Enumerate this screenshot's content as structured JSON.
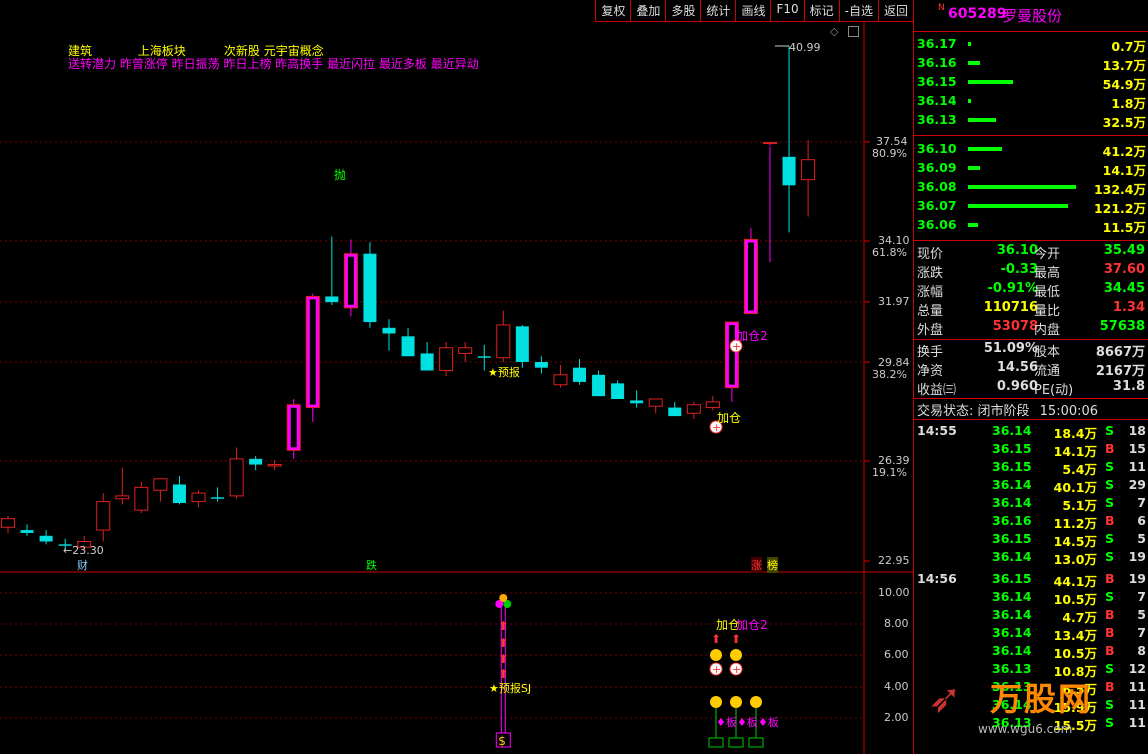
{
  "toolbar": [
    "复权",
    "叠加",
    "多股",
    "统计",
    "画线",
    "F10",
    "标记",
    "-自选",
    "返回"
  ],
  "tags": {
    "line1": "建筑            上海板块          次新股 元宇宙概念",
    "line2": "送转潜力 昨曾涨停 昨日振荡 昨日上榜 昨高换手 最近闪拉 最近多板 最近异动"
  },
  "price_axis": [
    "37.54",
    "80.9%",
    "34.10",
    "61.8%",
    "31.97",
    "29.84",
    "38.2%",
    "26.39",
    "19.1%",
    "22.95"
  ],
  "sub_axis": [
    "10.00",
    "8.00",
    "6.00",
    "4.00",
    "2.00"
  ],
  "annotations": {
    "high": "40.99",
    "low": "23.30",
    "pao": "抛",
    "forecast": "★预报",
    "jiacang": "加仓",
    "jiacang2": "加仓2",
    "cai": "财",
    "die": "跌",
    "zhang": "涨",
    "bang": "榜",
    "sub_forecast": "★预报SJ",
    "sub_jiacang": "加仓",
    "sub_jiacang2": "加仓2",
    "board": "♦板"
  },
  "stock": {
    "flag": "N",
    "code": "605289",
    "name": "罗曼股份"
  },
  "order_book": {
    "asks": [
      {
        "price": "36.17",
        "vol": "0.7万",
        "bar": 3
      },
      {
        "price": "36.16",
        "vol": "13.7万",
        "bar": 12
      },
      {
        "price": "36.15",
        "vol": "54.9万",
        "bar": 45
      },
      {
        "price": "36.14",
        "vol": "1.8万",
        "bar": 3
      },
      {
        "price": "36.13",
        "vol": "32.5万",
        "bar": 28
      }
    ],
    "bids": [
      {
        "price": "36.10",
        "vol": "41.2万",
        "bar": 34
      },
      {
        "price": "36.09",
        "vol": "14.1万",
        "bar": 12
      },
      {
        "price": "36.08",
        "vol": "132.4万",
        "bar": 108
      },
      {
        "price": "36.07",
        "vol": "121.2万",
        "bar": 100
      },
      {
        "price": "36.06",
        "vol": "11.5万",
        "bar": 10
      }
    ]
  },
  "quote": [
    {
      "l": "现价",
      "v": "36.10",
      "vc": "#0f0",
      "l2": "今开",
      "v2": "35.49",
      "v2c": "#0f0"
    },
    {
      "l": "涨跌",
      "v": "-0.33",
      "vc": "#0f0",
      "l2": "最高",
      "v2": "37.60",
      "v2c": "#f33"
    },
    {
      "l": "涨幅",
      "v": "-0.91%",
      "vc": "#0f0",
      "l2": "最低",
      "v2": "34.45",
      "v2c": "#0f0"
    },
    {
      "l": "总量",
      "v": "110716",
      "vc": "#ff0",
      "l2": "量比",
      "v2": "1.34",
      "v2c": "#f33"
    },
    {
      "l": "外盘",
      "v": "53078",
      "vc": "#f33",
      "l2": "内盘",
      "v2": "57638",
      "v2c": "#0f0"
    },
    {
      "l": "换手",
      "v": "51.09%",
      "vc": "#ddd",
      "l2": "股本",
      "v2": "8667万",
      "v2c": "#ddd"
    },
    {
      "l": "净资",
      "v": "14.56",
      "vc": "#ddd",
      "l2": "流通",
      "v2": "2167万",
      "v2c": "#ddd"
    },
    {
      "l": "收益㈢",
      "v": "0.960",
      "vc": "#ddd",
      "l2": "PE(动)",
      "v2": "31.8",
      "v2c": "#ddd"
    }
  ],
  "status": {
    "label": "交易状态: 闭市阶段",
    "time": "15:00:06"
  },
  "ticks": [
    {
      "t": "14:55",
      "p": "36.14",
      "v": "18.4万",
      "d": "S",
      "n": "18"
    },
    {
      "t": "",
      "p": "36.15",
      "v": "14.1万",
      "d": "B",
      "n": "15"
    },
    {
      "t": "",
      "p": "36.15",
      "v": "5.4万",
      "d": "S",
      "n": "11"
    },
    {
      "t": "",
      "p": "36.14",
      "v": "40.1万",
      "d": "S",
      "n": "29"
    },
    {
      "t": "",
      "p": "36.14",
      "v": "5.1万",
      "d": "S",
      "n": "7"
    },
    {
      "t": "",
      "p": "36.16",
      "v": "11.2万",
      "d": "B",
      "n": "6"
    },
    {
      "t": "",
      "p": "36.15",
      "v": "14.5万",
      "d": "S",
      "n": "5"
    },
    {
      "t": "",
      "p": "36.14",
      "v": "13.0万",
      "d": "S",
      "n": "19"
    },
    {
      "t": "14:56",
      "p": "36.15",
      "v": "44.1万",
      "d": "B",
      "n": "19"
    },
    {
      "t": "",
      "p": "36.14",
      "v": "10.5万",
      "d": "S",
      "n": "7"
    },
    {
      "t": "",
      "p": "36.14",
      "v": "4.7万",
      "d": "B",
      "n": "5"
    },
    {
      "t": "",
      "p": "36.14",
      "v": "13.4万",
      "d": "B",
      "n": "7"
    },
    {
      "t": "",
      "p": "36.14",
      "v": "10.5万",
      "d": "B",
      "n": "8"
    },
    {
      "t": "",
      "p": "36.13",
      "v": "10.8万",
      "d": "S",
      "n": "12"
    },
    {
      "t": "",
      "p": "36.13",
      "v": "6.5万",
      "d": "B",
      "n": "11"
    },
    {
      "t": "",
      "p": "36.14",
      "v": "15.9万",
      "d": "S",
      "n": "11"
    },
    {
      "t": "",
      "p": "36.13",
      "v": "15.5万",
      "d": "S",
      "n": "11"
    }
  ],
  "watermark": "万股网",
  "watermark_url": "www.wgu6.com",
  "chart_data": {
    "type": "candlestick",
    "ohlc": [
      [
        24.1,
        24.5,
        23.9,
        24.4
      ],
      [
        24.0,
        24.2,
        23.8,
        23.9
      ],
      [
        23.8,
        24.0,
        23.5,
        23.6
      ],
      [
        23.5,
        23.7,
        23.3,
        23.45
      ],
      [
        23.4,
        23.8,
        23.3,
        23.6
      ],
      [
        24.0,
        25.3,
        23.6,
        25.0
      ],
      [
        25.1,
        26.2,
        24.9,
        25.2
      ],
      [
        24.7,
        25.7,
        24.6,
        25.5
      ],
      [
        25.4,
        25.7,
        25.0,
        25.8
      ],
      [
        25.6,
        25.9,
        24.9,
        24.95
      ],
      [
        25.0,
        25.4,
        24.8,
        25.3
      ],
      [
        25.15,
        25.5,
        25.0,
        25.1
      ],
      [
        25.2,
        26.9,
        25.1,
        26.5
      ],
      [
        26.5,
        26.6,
        26.1,
        26.3
      ],
      [
        26.25,
        26.45,
        26.1,
        26.3
      ],
      [
        26.8,
        28.6,
        26.5,
        28.4
      ],
      [
        28.3,
        32.3,
        27.8,
        32.2
      ],
      [
        32.2,
        34.3,
        31.9,
        32.0
      ],
      [
        31.8,
        34.2,
        31.5,
        33.7
      ],
      [
        33.7,
        34.1,
        31.1,
        31.3
      ],
      [
        31.1,
        31.4,
        30.3,
        30.9
      ],
      [
        30.8,
        31.1,
        30.6,
        30.1
      ],
      [
        30.2,
        30.6,
        29.8,
        29.6
      ],
      [
        29.6,
        30.6,
        29.4,
        30.4
      ],
      [
        30.2,
        30.6,
        29.9,
        30.4
      ],
      [
        30.1,
        30.5,
        29.6,
        30.05
      ],
      [
        30.05,
        31.7,
        29.9,
        31.2
      ],
      [
        31.15,
        31.2,
        29.7,
        29.9
      ],
      [
        29.9,
        30.1,
        29.5,
        29.7
      ],
      [
        29.1,
        29.8,
        29.0,
        29.45
      ],
      [
        29.7,
        30.0,
        29.1,
        29.2
      ],
      [
        29.45,
        29.6,
        28.7,
        28.7
      ],
      [
        29.15,
        29.25,
        28.8,
        28.6
      ],
      [
        28.55,
        28.9,
        28.3,
        28.45
      ],
      [
        28.35,
        28.6,
        28.1,
        28.6
      ],
      [
        28.3,
        28.5,
        28.0,
        28.0
      ],
      [
        28.1,
        28.5,
        27.9,
        28.4
      ],
      [
        28.3,
        28.7,
        28.2,
        28.5
      ],
      [
        29.0,
        31.3,
        28.5,
        31.3
      ],
      [
        31.6,
        34.6,
        31.6,
        34.2
      ],
      [
        37.6,
        37.6,
        33.4,
        37.6
      ],
      [
        37.1,
        40.99,
        34.45,
        36.1
      ],
      [
        36.3,
        37.7,
        35.0,
        37.0
      ]
    ],
    "yrange": [
      22.95,
      40.99
    ],
    "sub_series": [
      {
        "name": "预报SJ",
        "x": 26,
        "value": 4.0
      },
      {
        "name": "加仓",
        "x": 39,
        "value": 8.0
      },
      {
        "name": "加仓2",
        "x": 40,
        "value": 8.0
      }
    ]
  }
}
